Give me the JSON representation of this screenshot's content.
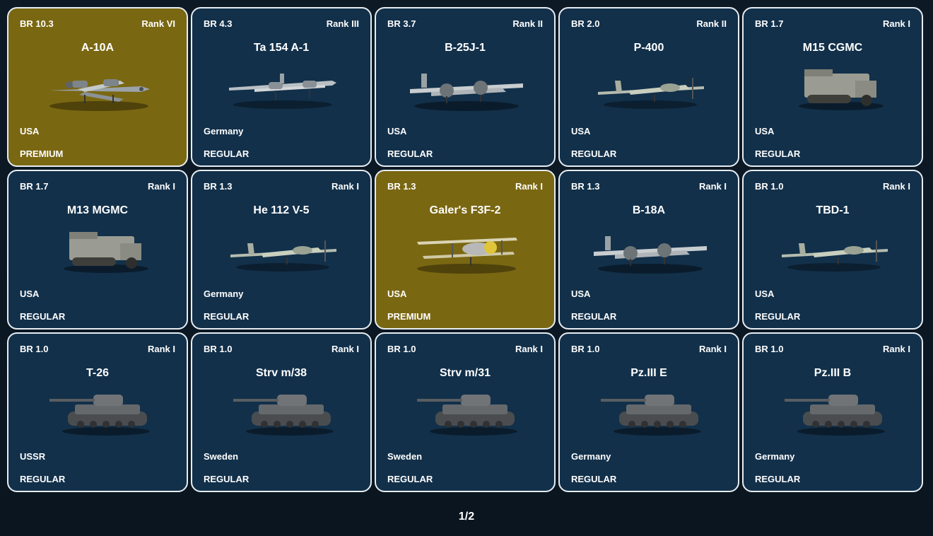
{
  "cards": [
    {
      "br": "BR 10.3",
      "rank": "Rank VI",
      "name": "A-10A",
      "nation": "USA",
      "type": "PREMIUM",
      "kind": "jet-icon"
    },
    {
      "br": "BR 4.3",
      "rank": "Rank III",
      "name": "Ta 154 A-1",
      "nation": "Germany",
      "type": "REGULAR",
      "kind": "twin-engine-plane-icon"
    },
    {
      "br": "BR 3.7",
      "rank": "Rank II",
      "name": "B-25J-1",
      "nation": "USA",
      "type": "REGULAR",
      "kind": "bomber-icon"
    },
    {
      "br": "BR 2.0",
      "rank": "Rank II",
      "name": "P-400",
      "nation": "USA",
      "type": "REGULAR",
      "kind": "fighter-plane-icon"
    },
    {
      "br": "BR 1.7",
      "rank": "Rank I",
      "name": "M15 CGMC",
      "nation": "USA",
      "type": "REGULAR",
      "kind": "halftrack-icon"
    },
    {
      "br": "BR 1.7",
      "rank": "Rank I",
      "name": "M13 MGMC",
      "nation": "USA",
      "type": "REGULAR",
      "kind": "halftrack-icon"
    },
    {
      "br": "BR 1.3",
      "rank": "Rank I",
      "name": "He 112 V-5",
      "nation": "Germany",
      "type": "REGULAR",
      "kind": "fighter-plane-icon"
    },
    {
      "br": "BR 1.3",
      "rank": "Rank I",
      "name": "Galer's F3F-2",
      "nation": "USA",
      "type": "PREMIUM",
      "kind": "biplane-icon"
    },
    {
      "br": "BR 1.3",
      "rank": "Rank I",
      "name": "B-18A",
      "nation": "USA",
      "type": "REGULAR",
      "kind": "bomber-icon"
    },
    {
      "br": "BR 1.0",
      "rank": "Rank I",
      "name": "TBD-1",
      "nation": "USA",
      "type": "REGULAR",
      "kind": "fighter-plane-icon"
    },
    {
      "br": "BR 1.0",
      "rank": "Rank I",
      "name": "T-26",
      "nation": "USSR",
      "type": "REGULAR",
      "kind": "tank-icon"
    },
    {
      "br": "BR 1.0",
      "rank": "Rank I",
      "name": "Strv m/38",
      "nation": "Sweden",
      "type": "REGULAR",
      "kind": "tank-icon"
    },
    {
      "br": "BR 1.0",
      "rank": "Rank I",
      "name": "Strv m/31",
      "nation": "Sweden",
      "type": "REGULAR",
      "kind": "tank-icon"
    },
    {
      "br": "BR 1.0",
      "rank": "Rank I",
      "name": "Pz.III E",
      "nation": "Germany",
      "type": "REGULAR",
      "kind": "tank-icon"
    },
    {
      "br": "BR 1.0",
      "rank": "Rank I",
      "name": "Pz.III B",
      "nation": "Germany",
      "type": "REGULAR",
      "kind": "tank-icon"
    }
  ],
  "pagination": {
    "label": "1/2"
  },
  "colors": {
    "card_regular": "#12304a",
    "card_premium": "#7a6712",
    "card_border": "#e6ecf2",
    "background": "#0c1824"
  }
}
